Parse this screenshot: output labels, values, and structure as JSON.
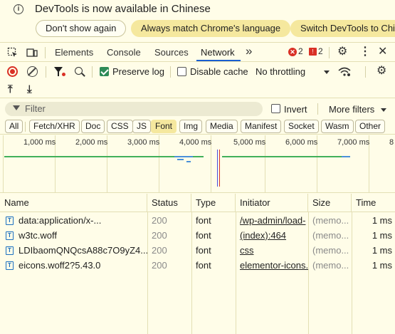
{
  "infobar": {
    "message": "DevTools is now available in Chinese",
    "dont_show": "Don't show again",
    "match_language": "Always match Chrome's language",
    "switch_language": "Switch DevTools to Chin"
  },
  "main_tabs": {
    "elements": "Elements",
    "console": "Console",
    "sources": "Sources",
    "network": "Network",
    "more": "»",
    "error_count": "2",
    "issue_count": "2"
  },
  "toolbar": {
    "preserve_log": "Preserve log",
    "preserve_log_checked": true,
    "disable_cache": "Disable cache",
    "disable_cache_checked": false,
    "throttling": "No throttling"
  },
  "filter": {
    "placeholder": "Filter",
    "invert": "Invert",
    "more_filters": "More filters"
  },
  "type_filters": [
    "All",
    "Fetch/XHR",
    "Doc",
    "CSS",
    "JS",
    "Font",
    "Img",
    "Media",
    "Manifest",
    "Socket",
    "Wasm",
    "Other"
  ],
  "active_type": "Font",
  "timeline": {
    "ticks": [
      "1,000 ms",
      "2,000 ms",
      "3,000 ms",
      "4,000 ms",
      "5,000 ms",
      "6,000 ms",
      "7,000 ms",
      "8"
    ]
  },
  "table": {
    "columns": [
      "Name",
      "Status",
      "Type",
      "Initiator",
      "Size",
      "Time"
    ],
    "rows": [
      {
        "name": "data:application/x-...",
        "status": "200",
        "type": "font",
        "initiator": "/wp-admin/load-",
        "size": "(memo...",
        "time": "1 ms"
      },
      {
        "name": "w3tc.woff",
        "status": "200",
        "type": "font",
        "initiator": "(index):464",
        "size": "(memo...",
        "time": "1 ms"
      },
      {
        "name": "LDIbaomQNQcsA88c7O9yZ4...",
        "status": "200",
        "type": "font",
        "initiator": "css",
        "size": "(memo...",
        "time": "1 ms"
      },
      {
        "name": "eicons.woff2?5.43.0",
        "status": "200",
        "type": "font",
        "initiator": "elementor-icons.",
        "size": "(memo...",
        "time": "1 ms"
      }
    ]
  },
  "colors": {
    "background": "#fffde8",
    "accent_yellow": "#f5e89e",
    "active_tab_underline": "#1a5fd0",
    "error_red": "#d93025",
    "checkbox_green": "#2e8b57"
  },
  "icons": [
    "info-icon",
    "inspect-icon",
    "device-icon",
    "gear-icon",
    "kebab-icon",
    "close-icon",
    "record-icon",
    "clear-icon",
    "filter-icon",
    "search-icon",
    "wifi-icon",
    "upload-icon",
    "download-icon",
    "font-file-icon"
  ]
}
